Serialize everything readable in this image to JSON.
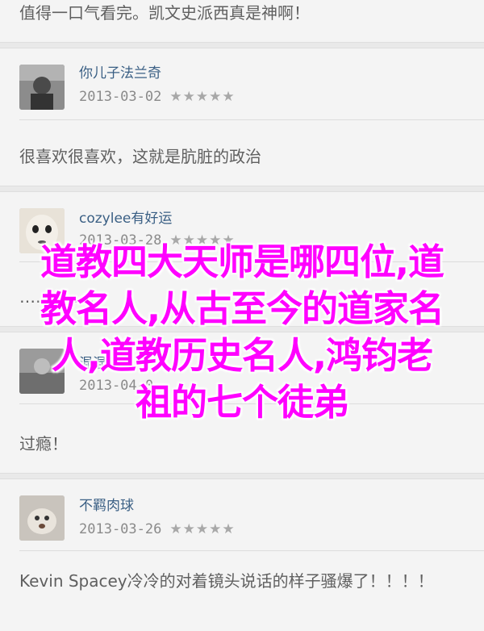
{
  "comments": [
    {
      "text": "值得一口气看完。凯文史派西真是神啊！"
    },
    {
      "user": "你儿子法兰奇",
      "date": "2013-03-02",
      "stars": "★★★★★",
      "text": "很喜欢很喜欢，这就是肮脏的政治"
    },
    {
      "user": "cozylee有好运",
      "date": "2013-03-28",
      "stars": "★★★★★",
      "text": "……………"
    },
    {
      "user": "混混阳",
      "date": "2013-04-0",
      "stars": "",
      "text": "过瘾！"
    },
    {
      "user": "不羁肉球",
      "date": "2013-03-26",
      "stars": "★★★★★",
      "text": "Kevin Spacey冷冷的对着镜头说话的样子骚爆了！！！！"
    }
  ],
  "overlay": {
    "lines": [
      "道教四大天师是哪四位,道",
      "教名人,从古至今的道家名",
      "人,道教历史名人,鸿钧老",
      "祖的七个徒弟"
    ]
  },
  "colors": {
    "overlay": "#ff00ff",
    "username": "#3a5f84"
  }
}
